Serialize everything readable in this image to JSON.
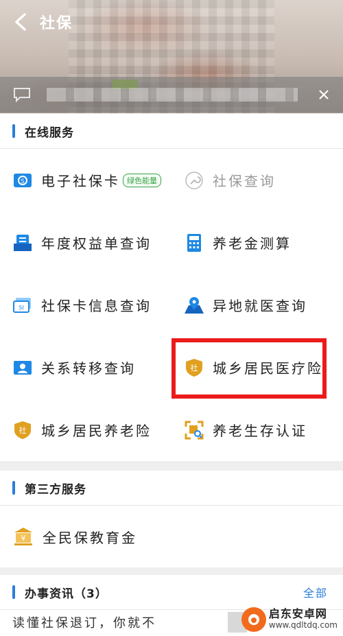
{
  "header": {
    "title": "社保"
  },
  "online_services": {
    "heading": "在线服务",
    "items": [
      {
        "label": "电子社保卡",
        "badge": "绿色能量",
        "icon": "social-card-icon"
      },
      {
        "label": "社保查询",
        "icon": "wrench-icon"
      },
      {
        "label": "年度权益单查询",
        "icon": "document-tray-icon"
      },
      {
        "label": "养老金测算",
        "icon": "calculator-icon"
      },
      {
        "label": "社保卡信息查询",
        "icon": "si-card-icon"
      },
      {
        "label": "异地就医查询",
        "icon": "map-pin-icon"
      },
      {
        "label": "关系转移查询",
        "icon": "person-card-icon"
      },
      {
        "label": "城乡居民医疗险",
        "icon": "she-shield-icon"
      },
      {
        "label": "城乡居民养老险",
        "icon": "she-shield-icon"
      },
      {
        "label": "养老生存认证",
        "icon": "face-scan-icon"
      }
    ]
  },
  "third_party": {
    "heading": "第三方服务",
    "items": [
      {
        "label": "全民保教育金",
        "icon": "bank-yuan-icon"
      }
    ]
  },
  "news": {
    "heading": "办事资讯（3）",
    "more_label": "全部",
    "first_item": "读懂社保退订，你就不"
  },
  "watermark": {
    "name": "启东安卓网",
    "url": "www.qdltdq.com"
  },
  "colors": {
    "accent": "#2a7ed8",
    "highlight": "#ec1b1b",
    "badge": "#3aa34a",
    "icon_orange": "#e0a020"
  }
}
